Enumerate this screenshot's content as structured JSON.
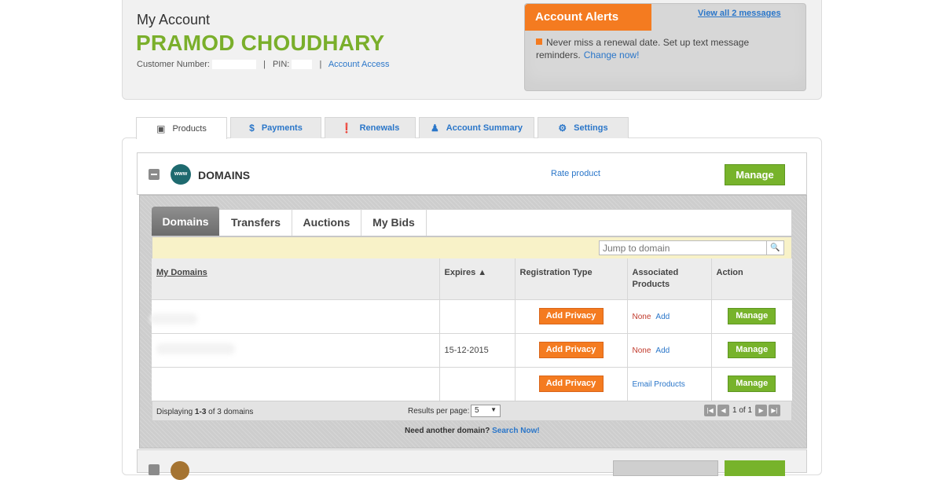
{
  "header": {
    "title": "My Account",
    "customer_name": "PRAMOD CHOUDHARY",
    "customer_number_label": "Customer Number:",
    "pin_label": "PIN:",
    "account_access": "Account Access"
  },
  "alerts": {
    "title": "Account Alerts",
    "view_all": "View all 2 messages",
    "message": "Never miss a renewal date. Set up text message reminders.",
    "change_now": "Change now!"
  },
  "main_tabs": [
    {
      "label": "Products",
      "icon": "box-icon"
    },
    {
      "label": "Payments",
      "icon": "dollar-icon"
    },
    {
      "label": "Renewals",
      "icon": "exclamation-icon"
    },
    {
      "label": "Account Summary",
      "icon": "person-icon"
    },
    {
      "label": "Settings",
      "icon": "gear-icon"
    }
  ],
  "product": {
    "title": "DOMAINS",
    "icon_text": "www",
    "rate_product": "Rate product",
    "manage": "Manage"
  },
  "sub_tabs": [
    "Domains",
    "Transfers",
    "Auctions",
    "My Bids"
  ],
  "search": {
    "placeholder": "Jump to domain"
  },
  "table": {
    "headers": {
      "domains": "My Domains",
      "expires": "Expires ▲",
      "registration_type": "Registration Type",
      "associated_products": "Associated Products",
      "action": "Action"
    },
    "rows": [
      {
        "expires": "",
        "privacy": "Add Privacy",
        "assoc_none": "None",
        "assoc_add": "Add",
        "assoc_link": "",
        "manage": "Manage"
      },
      {
        "expires": "15-12-2015",
        "privacy": "Add Privacy",
        "assoc_none": "None",
        "assoc_add": "Add",
        "assoc_link": "",
        "manage": "Manage"
      },
      {
        "expires": "",
        "privacy": "Add Privacy",
        "assoc_none": "",
        "assoc_add": "",
        "assoc_link": "Email Products",
        "manage": "Manage"
      }
    ]
  },
  "footer": {
    "displaying_prefix": "Displaying ",
    "displaying_range": "1-3",
    "displaying_suffix": " of 3 domains",
    "results_per_page": "Results per page:",
    "per_page_value": "5",
    "page_status": "1 of 1"
  },
  "need_another": {
    "text": "Need another domain?",
    "link": "Search Now!"
  },
  "colors": {
    "brand_green": "#77b32b",
    "name_green": "#7aaf2b",
    "accent_orange": "#f47b20",
    "link_blue": "#2a76c9"
  }
}
